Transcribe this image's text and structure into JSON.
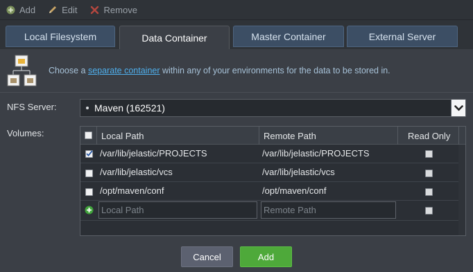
{
  "toolbar": {
    "add_label": "Add",
    "edit_label": "Edit",
    "remove_label": "Remove"
  },
  "tabs": [
    {
      "label": "Local Filesystem",
      "active": false
    },
    {
      "label": "Data Container",
      "active": true
    },
    {
      "label": "Master Container",
      "active": false
    },
    {
      "label": "External Server",
      "active": false
    }
  ],
  "info": {
    "prefix": "Choose a ",
    "link": "separate container",
    "suffix": " within any of your environments for the data to be stored in."
  },
  "nfs": {
    "label": "NFS Server:",
    "value": "Maven (162521)"
  },
  "volumes": {
    "label": "Volumes:",
    "columns": {
      "local": "Local Path",
      "remote": "Remote Path",
      "readonly": "Read Only"
    },
    "rows": [
      {
        "local": "/var/lib/jelastic/PROJECTS",
        "remote": "/var/lib/jelastic/PROJECTS",
        "checked": true,
        "readonly": false
      },
      {
        "local": "/var/lib/jelastic/vcs",
        "remote": "/var/lib/jelastic/vcs",
        "checked": false,
        "readonly": false
      },
      {
        "local": "/opt/maven/conf",
        "remote": "/opt/maven/conf",
        "checked": false,
        "readonly": false
      }
    ],
    "new_row": {
      "local_placeholder": "Local Path",
      "remote_placeholder": "Remote Path"
    }
  },
  "buttons": {
    "cancel": "Cancel",
    "add": "Add"
  },
  "colors": {
    "accent_green": "#4ea93a",
    "tab_blue": "#3c4e64",
    "link": "#4fb0ee"
  }
}
